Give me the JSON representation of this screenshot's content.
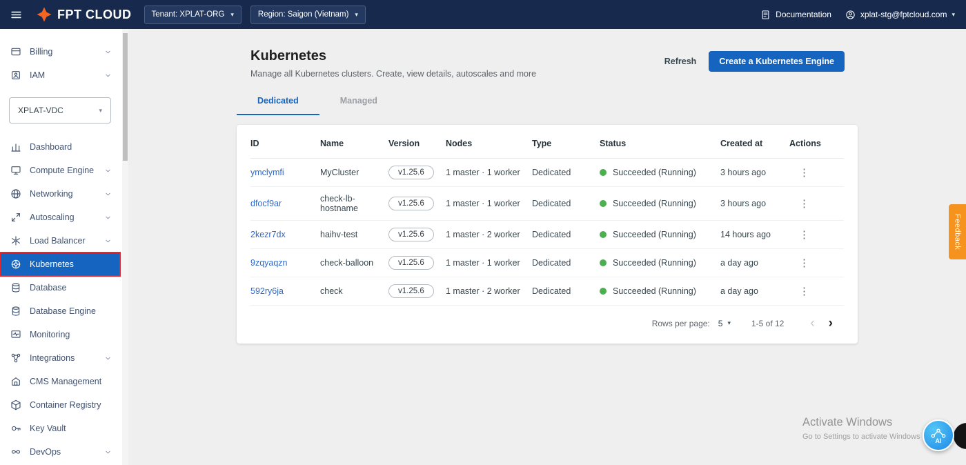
{
  "topbar": {
    "brand": "FPT CLOUD",
    "tenant_label": "Tenant: XPLAT-ORG",
    "region_label": "Region: Saigon (Vietnam)",
    "documentation_label": "Documentation",
    "user_email": "xplat-stg@fptcloud.com"
  },
  "sidebar": {
    "top_items": [
      {
        "label": "Billing",
        "expandable": true
      },
      {
        "label": "IAM",
        "expandable": true
      }
    ],
    "vdc_select_value": "XPLAT-VDC",
    "items": [
      {
        "label": "Dashboard",
        "expandable": false
      },
      {
        "label": "Compute Engine",
        "expandable": true
      },
      {
        "label": "Networking",
        "expandable": true
      },
      {
        "label": "Autoscaling",
        "expandable": true
      },
      {
        "label": "Load Balancer",
        "expandable": true
      },
      {
        "label": "Kubernetes",
        "expandable": false,
        "active": true
      },
      {
        "label": "Database",
        "expandable": false
      },
      {
        "label": "Database Engine",
        "expandable": false
      },
      {
        "label": "Monitoring",
        "expandable": false
      },
      {
        "label": "Integrations",
        "expandable": true
      },
      {
        "label": "CMS Management",
        "expandable": false
      },
      {
        "label": "Container Registry",
        "expandable": false
      },
      {
        "label": "Key Vault",
        "expandable": false
      },
      {
        "label": "DevOps",
        "expandable": true
      }
    ]
  },
  "main": {
    "title": "Kubernetes",
    "subtitle": "Manage all Kubernetes clusters. Create, view details, autoscales and more",
    "refresh_label": "Refresh",
    "create_button_label": "Create a Kubernetes Engine",
    "tabs": [
      {
        "label": "Dedicated",
        "active": true
      },
      {
        "label": "Managed",
        "active": false
      }
    ],
    "table": {
      "columns": [
        "ID",
        "Name",
        "Version",
        "Nodes",
        "Type",
        "Status",
        "Created at",
        "Actions"
      ],
      "rows": [
        {
          "id": "ymclymfi",
          "name": "MyCluster",
          "version": "v1.25.6",
          "nodes": "1 master · 1 worker",
          "type": "Dedicated",
          "status": "Succeeded (Running)",
          "created": "3 hours ago"
        },
        {
          "id": "dfocf9ar",
          "name": "check-lb-hostname",
          "version": "v1.25.6",
          "nodes": "1 master · 1 worker",
          "type": "Dedicated",
          "status": "Succeeded (Running)",
          "created": "3 hours ago"
        },
        {
          "id": "2kezr7dx",
          "name": "haihv-test",
          "version": "v1.25.6",
          "nodes": "1 master · 2 worker",
          "type": "Dedicated",
          "status": "Succeeded (Running)",
          "created": "14 hours ago"
        },
        {
          "id": "9zqyaqzn",
          "name": "check-balloon",
          "version": "v1.25.6",
          "nodes": "1 master · 1 worker",
          "type": "Dedicated",
          "status": "Succeeded (Running)",
          "created": "a day ago"
        },
        {
          "id": "592ry6ja",
          "name": "check",
          "version": "v1.25.6",
          "nodes": "1 master · 2 worker",
          "type": "Dedicated",
          "status": "Succeeded (Running)",
          "created": "a day ago"
        }
      ]
    },
    "pagination": {
      "rows_per_page_label": "Rows per page:",
      "rows_per_page_value": "5",
      "range_label": "1-5 of 12"
    }
  },
  "feedback_tab_label": "Feedback",
  "watermark": {
    "line1": "Activate Windows",
    "line2": "Go to Settings to activate Windows"
  },
  "ai_widget_label": "AI",
  "colors": {
    "topbar_navy": "#172a4d",
    "accent_blue": "#1565c0",
    "status_green": "#4caf50",
    "feedback_orange": "#f6921e",
    "highlight_red": "#e8262b",
    "link_blue": "#3069c9"
  },
  "icons": {
    "kebab": "⋮",
    "caret_down": "▾",
    "chevron_left": "‹",
    "chevron_right": "›",
    "nodes_separator": "·"
  }
}
